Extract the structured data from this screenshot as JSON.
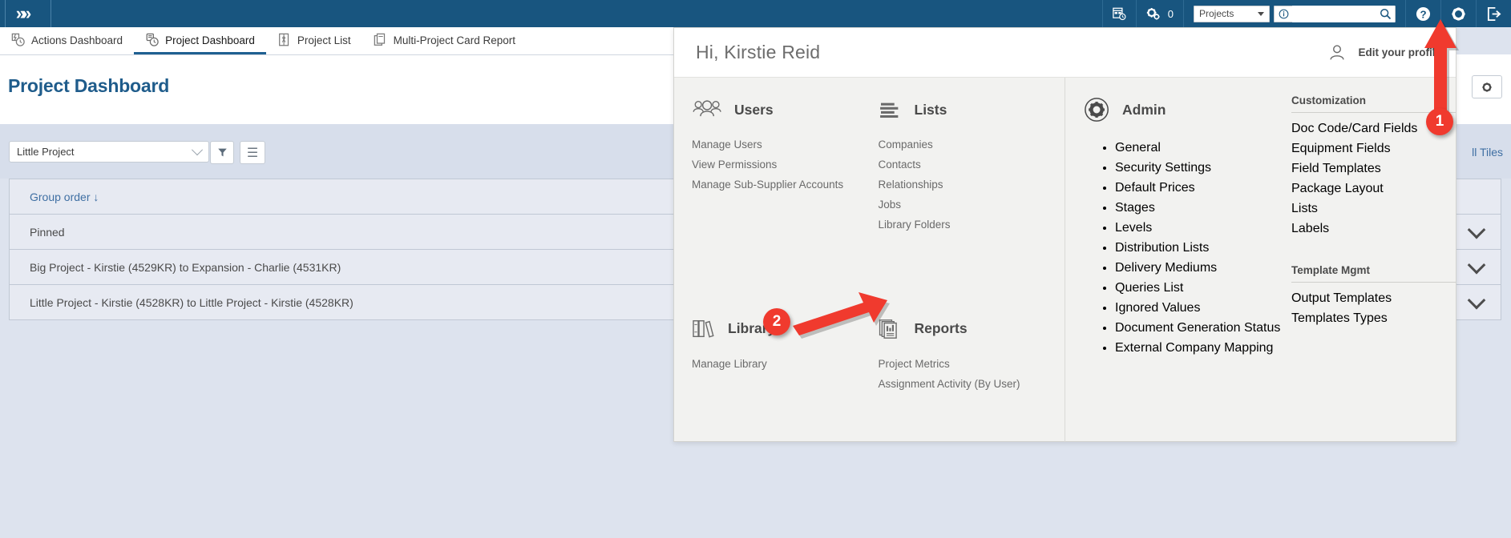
{
  "topbar": {
    "logo_icon": "chevrons-logo",
    "items": [
      {
        "name": "timesheet-icon",
        "icon": "calendar-clock-icon"
      },
      {
        "name": "settings-cogs-icon",
        "icon": "cogs-icon",
        "count": "0"
      }
    ],
    "project_select": {
      "value": "Projects",
      "caret": "chevron-down-icon"
    },
    "search": {
      "placeholder": "",
      "value": "",
      "info_icon": "info-icon",
      "search_icon": "search-icon"
    },
    "help_icon": "help-circle-icon",
    "gear_icon": "gear-icon",
    "logout_icon": "logout-icon"
  },
  "tabs": [
    {
      "label": "Actions Dashboard",
      "icon": "actions-dashboard-icon",
      "active": false
    },
    {
      "label": "Project Dashboard",
      "icon": "project-dashboard-icon",
      "active": true
    },
    {
      "label": "Project List",
      "icon": "project-list-icon",
      "active": false
    },
    {
      "label": "Multi-Project Card Report",
      "icon": "multi-project-card-report-icon",
      "active": false
    }
  ],
  "page": {
    "title": "Project Dashboard",
    "gear_button_icon": "gear-icon",
    "project_filter": {
      "value": "Little Project",
      "caret": "chevron-down-icon"
    },
    "filter_button_icon": "funnel-icon",
    "menu_button_icon": "hamburger-icon",
    "all_tiles_label": "ll Tiles",
    "rows": [
      {
        "label": "Group order ↓",
        "type": "header",
        "chevron": ""
      },
      {
        "label": "Pinned",
        "type": "group",
        "chevron": "chevron-down-icon"
      },
      {
        "label": "Big Project - Kirstie (4529KR) to Expansion - Charlie (4531KR)",
        "type": "item",
        "chevron": "chevron-down-icon"
      },
      {
        "label": "Little Project - Kirstie (4528KR) to Little Project - Kirstie (4528KR)",
        "type": "item",
        "chevron": "chevron-down-icon"
      }
    ]
  },
  "megamenu": {
    "greeting": "Hi, Kirstie Reid",
    "profile_label": "Edit your profile",
    "profile_icon": "user-avatar-icon",
    "sections": [
      {
        "title": "Users",
        "icon": "users-group-icon",
        "items": [
          "Manage Users",
          "View Permissions",
          "Manage Sub-Supplier Accounts"
        ]
      },
      {
        "title": "Lists",
        "icon": "list-lines-icon",
        "items": [
          "Companies",
          "Contacts",
          "Relationships",
          "Jobs",
          "Library Folders"
        ]
      },
      {
        "title": "Library",
        "icon": "books-icon",
        "items": [
          "Manage Library"
        ]
      },
      {
        "title": "Reports",
        "icon": "reports-chart-icon",
        "items": [
          "Project Metrics",
          "Assignment Activity (By User)"
        ]
      }
    ],
    "admin": {
      "title": "Admin",
      "icon": "admin-gear-icon",
      "items": [
        "General",
        "Security Settings",
        "Default Prices",
        "Stages",
        "Levels",
        "Distribution Lists",
        "Delivery Mediums",
        "Queries List",
        "Ignored Values",
        "Document Generation Status",
        "External Company Mapping"
      ]
    },
    "customization": {
      "title": "Customization",
      "items": [
        "Doc Code/Card Fields",
        "Equipment Fields",
        "Field Templates",
        "Package Layout",
        "Lists",
        "Labels"
      ]
    },
    "template_mgmt": {
      "title": "Template Mgmt",
      "items": [
        "Output Templates",
        "Templates Types"
      ]
    }
  },
  "annotations": [
    {
      "number": "1",
      "color": "#f03a2e",
      "target": "topbar-gear-icon"
    },
    {
      "number": "2",
      "color": "#f03a2e",
      "target": "assignment-activity-by-user-link"
    }
  ]
}
